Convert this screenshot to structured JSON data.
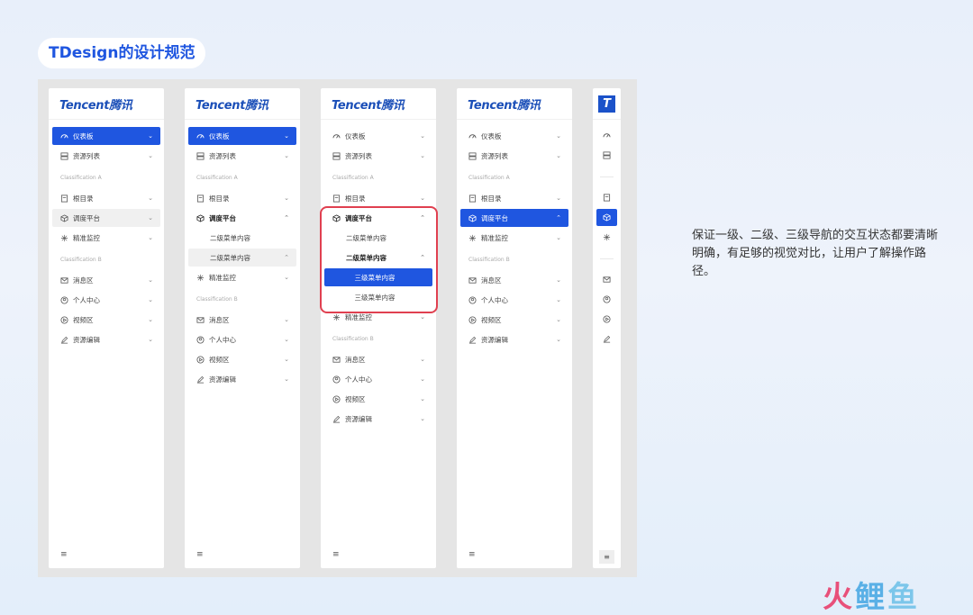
{
  "title": "TDesign的设计规范",
  "logo_text": "Tencent腾讯",
  "logo_mini_text": "T",
  "groups": {
    "a": "Classification A",
    "b": "Classification B"
  },
  "menu": {
    "dashboard": "仪表板",
    "resources": "资源列表",
    "root": "根目录",
    "scheduler": "调度平台",
    "monitor": "精准监控",
    "messages": "消息区",
    "profile": "个人中心",
    "video": "视频区",
    "editor": "资源编辑",
    "second_level": "二级菜单内容",
    "third_level": "三级菜单内容"
  },
  "arrows": {
    "down": "⌄",
    "up": "⌃"
  },
  "collapse_icon": "≡",
  "description": "保证一级、二级、三级导航的交互状态都要清晰明确，有足够的视觉对比，让用户了解操作路径。",
  "watermark": {
    "a": "火",
    "b": "鲤",
    "c": "鱼"
  },
  "colors": {
    "accent": "#1f56e0",
    "highlight": "#e04050",
    "brand": "#1b4fb8"
  }
}
